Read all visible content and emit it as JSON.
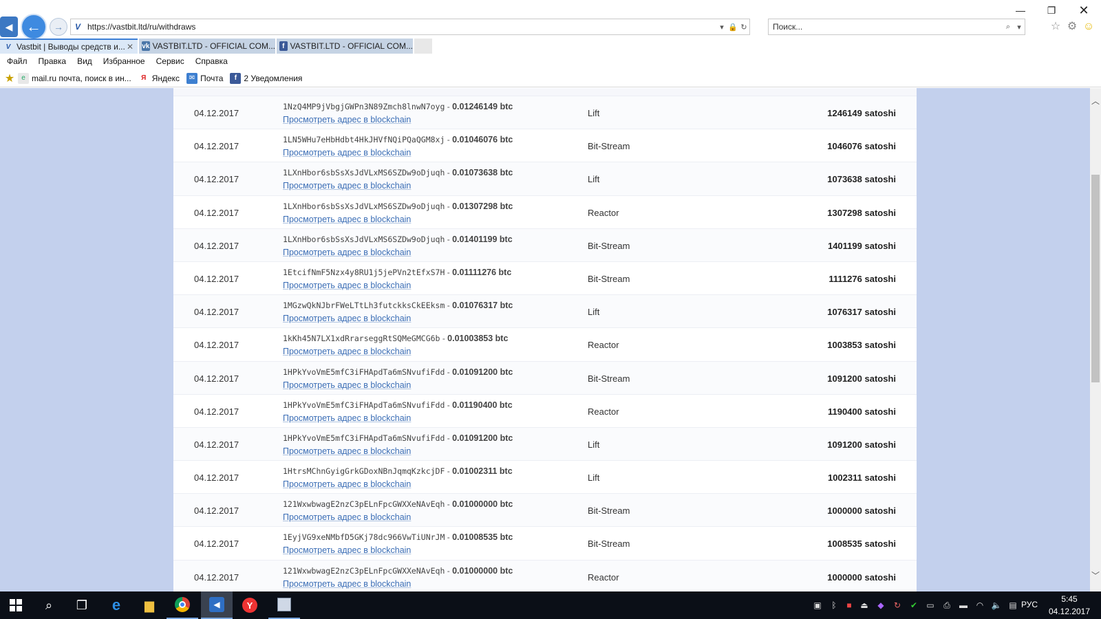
{
  "browser": {
    "url": "https://vastbit.ltd/ru/withdraws",
    "search_placeholder": "Поиск...",
    "site_letter": "V"
  },
  "tabs": [
    {
      "label": "Vastbit | Выводы средств и...",
      "icon": "vastbit-icon",
      "close": "✕"
    },
    {
      "label": "VASTBIT.LTD - OFFICIAL COM...",
      "icon": "vk-icon"
    },
    {
      "label": "VASTBIT.LTD - OFFICIAL COM...",
      "icon": "facebook-icon"
    }
  ],
  "menu": [
    "Файл",
    "Правка",
    "Вид",
    "Избранное",
    "Сервис",
    "Справка"
  ],
  "favorites": [
    {
      "label": "mail.ru почта, поиск в ин...",
      "icon": "page-icon"
    },
    {
      "label": "Яндекс",
      "icon": "yandex-icon"
    },
    {
      "label": "Почта",
      "icon": "mail-icon"
    },
    {
      "label": "2 Уведомления",
      "icon": "facebook-icon"
    }
  ],
  "withdraws": {
    "link_label": "Просмотреть адрес в blockchain",
    "separator": " - ",
    "rows": [
      {
        "date": "04.12.2017",
        "address": "1NzQ4MP9jVbgjGWPn3N89Zmch8lnwN7oyg",
        "btc": "0.01246149 btc",
        "plan": "Lift",
        "satoshi": "1246149 satoshi"
      },
      {
        "date": "04.12.2017",
        "address": "1LN5WHu7eHbHdbt4HkJHVfNQiPQaQGM8xj",
        "btc": "0.01046076 btc",
        "plan": "Bit-Stream",
        "satoshi": "1046076 satoshi"
      },
      {
        "date": "04.12.2017",
        "address": "1LXnHbor6sbSsXsJdVLxMS6SZDw9oDjuqh",
        "btc": "0.01073638 btc",
        "plan": "Lift",
        "satoshi": "1073638 satoshi"
      },
      {
        "date": "04.12.2017",
        "address": "1LXnHbor6sbSsXsJdVLxMS6SZDw9oDjuqh",
        "btc": "0.01307298 btc",
        "plan": "Reactor",
        "satoshi": "1307298 satoshi"
      },
      {
        "date": "04.12.2017",
        "address": "1LXnHbor6sbSsXsJdVLxMS6SZDw9oDjuqh",
        "btc": "0.01401199 btc",
        "plan": "Bit-Stream",
        "satoshi": "1401199 satoshi"
      },
      {
        "date": "04.12.2017",
        "address": "1EtcifNmF5Nzx4y8RU1j5jePVn2tEfxS7H",
        "btc": "0.01111276 btc",
        "plan": "Bit-Stream",
        "satoshi": "1111276 satoshi"
      },
      {
        "date": "04.12.2017",
        "address": "1MGzwQkNJbrFWeLTtLh3futckksCkEEksm",
        "btc": "0.01076317 btc",
        "plan": "Lift",
        "satoshi": "1076317 satoshi"
      },
      {
        "date": "04.12.2017",
        "address": "1kKh45N7LX1xdRrarseggRtSQMeGMCG6b",
        "btc": "0.01003853 btc",
        "plan": "Reactor",
        "satoshi": "1003853 satoshi"
      },
      {
        "date": "04.12.2017",
        "address": "1HPkYvoVmE5mfC3iFHApdTa6mSNvufiFdd",
        "btc": "0.01091200 btc",
        "plan": "Bit-Stream",
        "satoshi": "1091200 satoshi"
      },
      {
        "date": "04.12.2017",
        "address": "1HPkYvoVmE5mfC3iFHApdTa6mSNvufiFdd",
        "btc": "0.01190400 btc",
        "plan": "Reactor",
        "satoshi": "1190400 satoshi"
      },
      {
        "date": "04.12.2017",
        "address": "1HPkYvoVmE5mfC3iFHApdTa6mSNvufiFdd",
        "btc": "0.01091200 btc",
        "plan": "Lift",
        "satoshi": "1091200 satoshi"
      },
      {
        "date": "04.12.2017",
        "address": "1HtrsMChnGyigGrkGDoxNBnJqmqKzkcjDF",
        "btc": "0.01002311 btc",
        "plan": "Lift",
        "satoshi": "1002311 satoshi"
      },
      {
        "date": "04.12.2017",
        "address": "121WxwbwagE2nzC3pELnFpcGWXXeNAvEqh",
        "btc": "0.01000000 btc",
        "plan": "Bit-Stream",
        "satoshi": "1000000 satoshi"
      },
      {
        "date": "04.12.2017",
        "address": "1EyjVG9xeNMbfD5GKj78dc966VwTiUNrJM",
        "btc": "0.01008535 btc",
        "plan": "Bit-Stream",
        "satoshi": "1008535 satoshi"
      },
      {
        "date": "04.12.2017",
        "address": "121WxwbwagE2nzC3pELnFpcGWXXeNAvEqh",
        "btc": "0.01000000 btc",
        "plan": "Reactor",
        "satoshi": "1000000 satoshi"
      }
    ]
  },
  "taskbar": {
    "lang": "РУС",
    "time": "5:45",
    "date": "04.12.2017",
    "yandex_letter": "Y"
  },
  "colors": {
    "page_bg": "#c3d0ed",
    "link": "#3a6db5",
    "taskbar": "#0b0f17"
  }
}
